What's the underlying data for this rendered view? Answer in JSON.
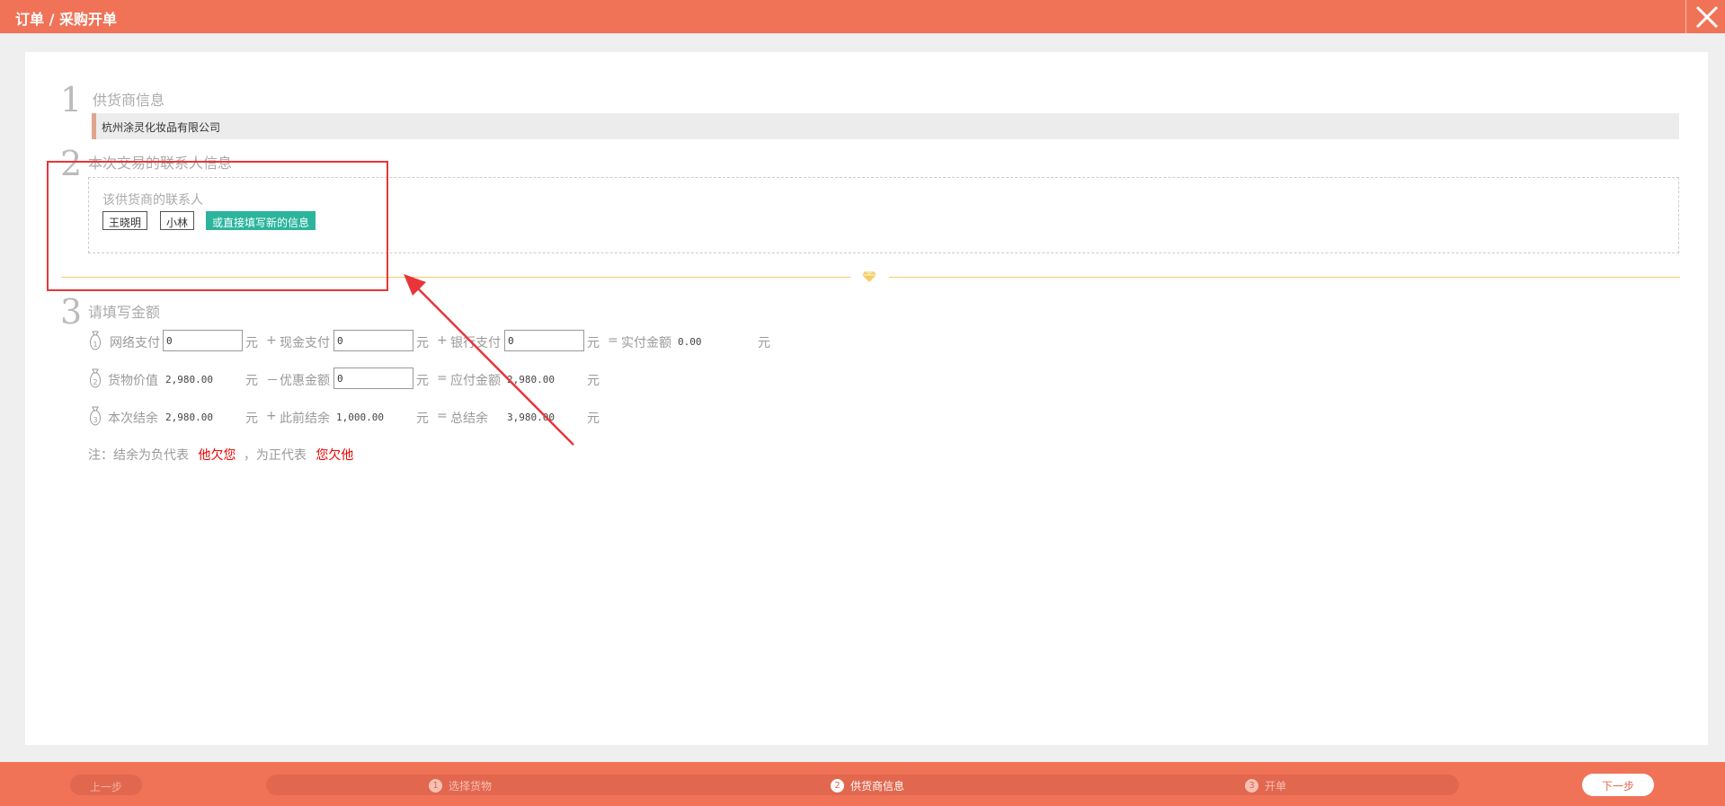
{
  "header": {
    "title": "订单 / 采购开单",
    "close_icon": "close-icon"
  },
  "section1": {
    "number": "1",
    "title": "供货商信息",
    "supplier_name": "杭州涂灵化妆品有限公司"
  },
  "section2": {
    "number": "2",
    "title": "本次交易的联系人信息",
    "contacts_label": "该供货商的联系人",
    "contacts": [
      "王晓明",
      "小林"
    ],
    "new_contact_label": "或直接填写新的信息"
  },
  "section3": {
    "number": "3",
    "title": "请填写金额",
    "unit": "元",
    "row1": {
      "online_label": "网络支付",
      "online_value": "0",
      "cash_label": "现金支付",
      "cash_value": "0",
      "bank_label": "银行支付",
      "bank_value": "0",
      "actual_label": "实付金额",
      "actual_value": "0.00",
      "op_plus": "+",
      "op_eq": "="
    },
    "row2": {
      "goods_label": "货物价值",
      "goods_value": "2,980.00",
      "discount_label": "优惠金额",
      "discount_value": "0",
      "payable_label": "应付金额",
      "payable_value": "2,980.00",
      "op_minus": "－",
      "op_eq": "="
    },
    "row3": {
      "balance_label": "本次结余",
      "balance_value": "2,980.00",
      "prev_label": "此前结余",
      "prev_value": "1,000.00",
      "total_label": "总结余",
      "total_value": "3,980.00",
      "op_plus": "+",
      "op_eq": "="
    },
    "note": {
      "prefix": "注：结余为负代表",
      "neg": "他欠您",
      "mid": "，为正代表",
      "pos": "您欠他"
    }
  },
  "footer": {
    "prev_label": "上一步",
    "next_label": "下一步",
    "steps": [
      {
        "num": "1",
        "label": "选择货物",
        "state": "done"
      },
      {
        "num": "2",
        "label": "供货商信息",
        "state": "active"
      },
      {
        "num": "3",
        "label": "开单",
        "state": "pending"
      }
    ]
  },
  "colors": {
    "brand": "#f07358",
    "accent_green": "#2ab59c",
    "annotation_red": "#e8353a",
    "divider_gold": "#f3ce66"
  }
}
